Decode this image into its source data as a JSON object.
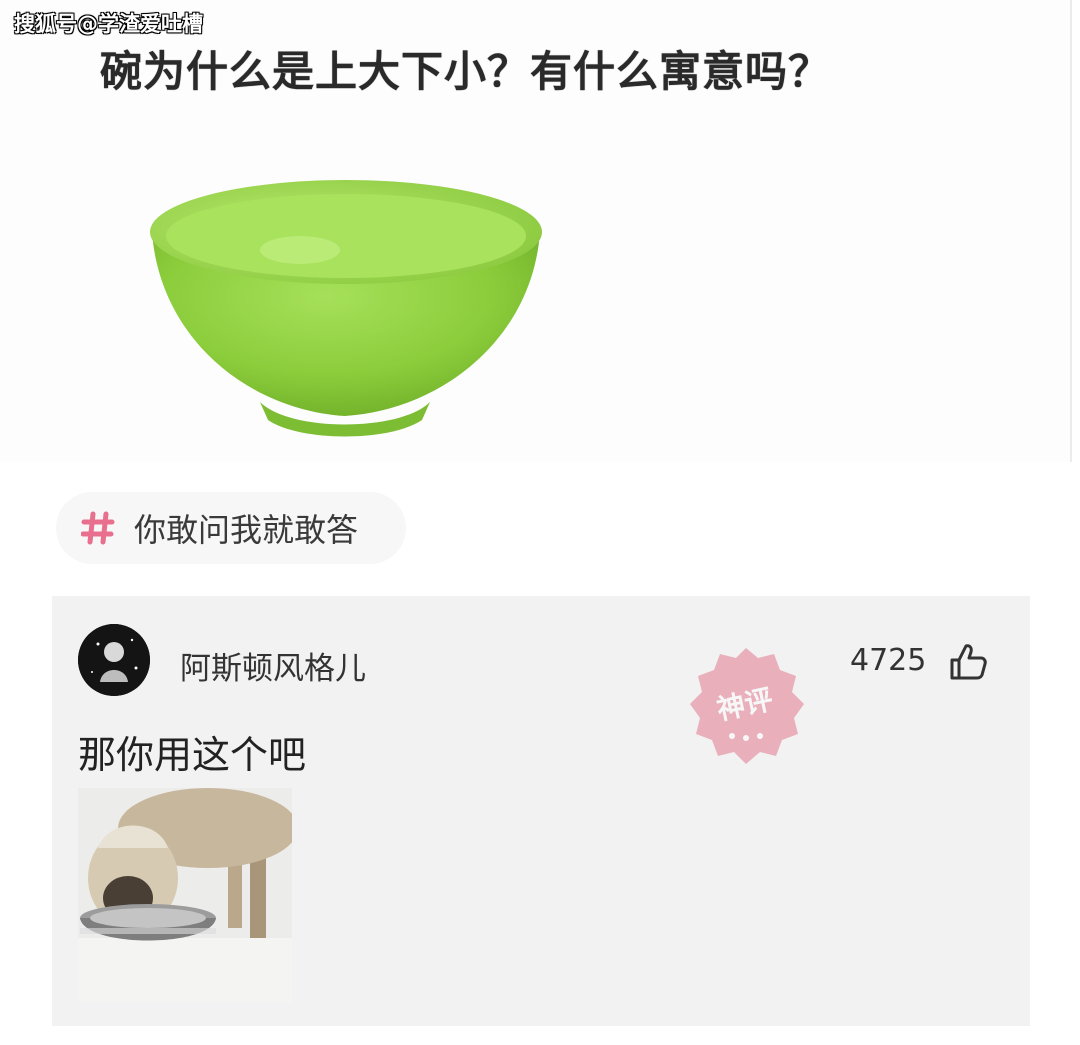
{
  "watermark": "搜狐号@学渣爱吐槽",
  "post": {
    "question": "碗为什么是上大下小？有什么寓意吗？"
  },
  "topic": {
    "label": "你敢问我就敢答"
  },
  "comment": {
    "username": "阿斯顿风格儿",
    "likes": "4725",
    "text": "那你用这个吧",
    "stamp_text": "神评"
  },
  "colors": {
    "bowl": "#8fd13f",
    "hash": "#e8708e",
    "stamp": "#e0607a"
  }
}
